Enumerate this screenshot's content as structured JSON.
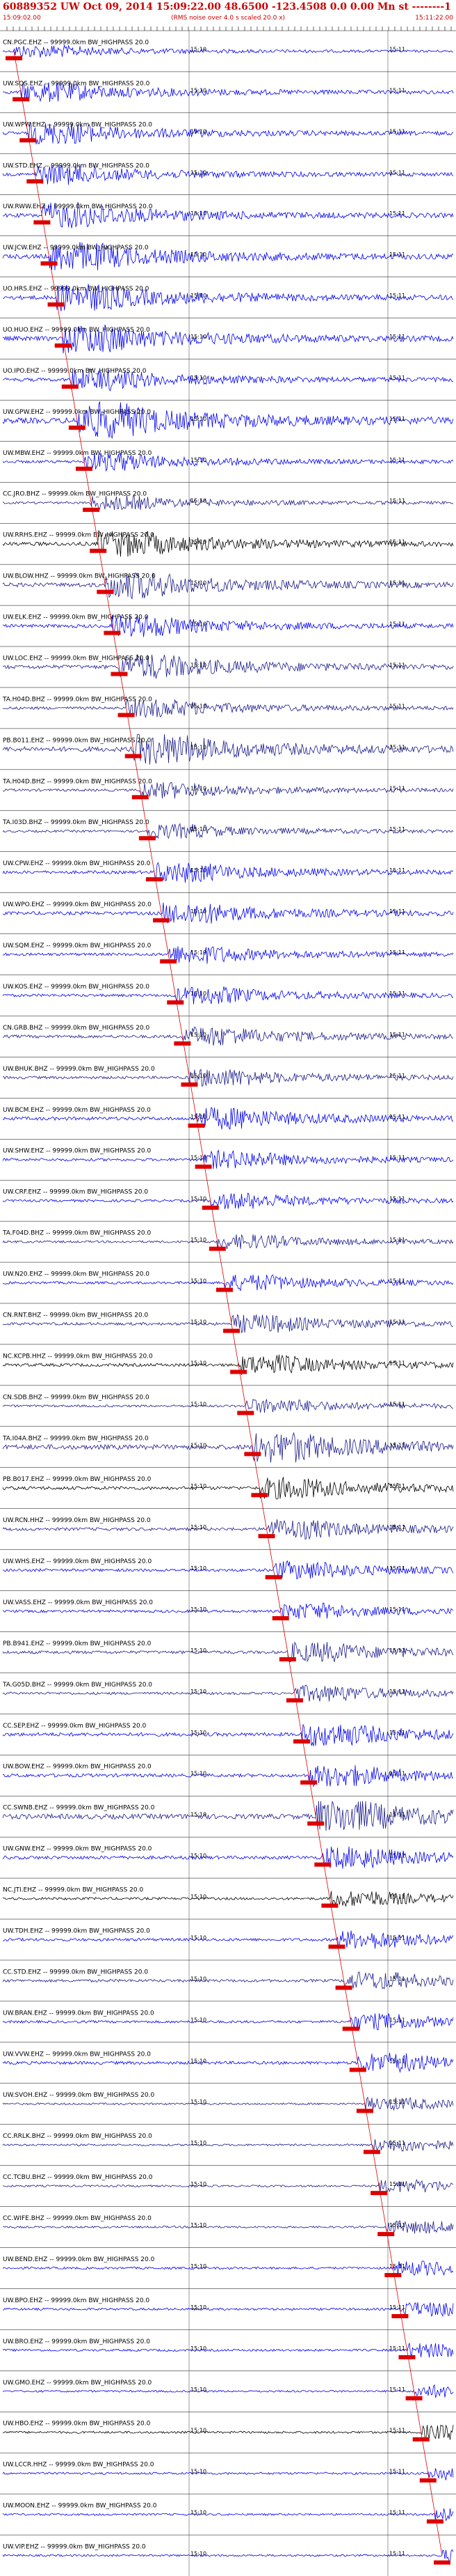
{
  "header": {
    "title": "60889352 UW Oct 09, 2014 15:09:22.00   48.6500 -123.4508  0.0 0.00 Mn st --------1",
    "start_time": "15:09:02.00",
    "scale_note": "(RMS noise over 4.0 s scaled 20.0 x)",
    "end_time": "15:11:22.00"
  },
  "chart_data": {
    "type": "line",
    "title": "60889352 UW Oct 09, 2014 15:09:22.00   48.6500 -123.4508  0.0 0.00 Mn st --------1",
    "x_time_labels": [
      "15:10",
      "15:11"
    ],
    "filter_suffix": "-- 99999.0km BW_HIGHPASS",
    "series_colors": [
      "#0000ee",
      "#1a1a8c",
      "#000000"
    ],
    "traces": [
      {
        "label": "CN.PGC.EHZ -- 99999.0km BW_HIGHPASS 20.0",
        "color": "#0000ee",
        "amp": 0.35
      },
      {
        "label": "UW.SQS.EHZ -- 99999.0km BW_HIGHPASS 20.0",
        "color": "#0000ee",
        "amp": 0.55
      },
      {
        "label": "UW.WPW.EHZ -- 99999.0km BW_HIGHPASS 20.0",
        "color": "#0000ee",
        "amp": 0.6
      },
      {
        "label": "UW.STD.EHZ -- 99999.0km BW_HIGHPASS 20.0",
        "color": "#0000ee",
        "amp": 0.55
      },
      {
        "label": "UW.RWW.EHZ -- 99999.0km BW_HIGHPASS 20.0",
        "color": "#0000ee",
        "amp": 0.7
      },
      {
        "label": "UW.JCW.EHZ -- 99999.0km BW_HIGHPASS 20.0",
        "color": "#0000ee",
        "amp": 0.8
      },
      {
        "label": "UO.HRS.EHZ -- 99999.0km BW_HIGHPASS 20.0",
        "color": "#0000ee",
        "amp": 0.75
      },
      {
        "label": "UO.HUO.EHZ -- 99999.0km BW_HIGHPASS 20.0",
        "color": "#0000ee",
        "amp": 0.8
      },
      {
        "label": "UO.IPO.EHZ -- 99999.0km BW_HIGHPASS 20.0",
        "color": "#0000ee",
        "amp": 0.6
      },
      {
        "label": "UW.GPW.EHZ -- 99999.0km BW_HIGHPASS 20.0",
        "color": "#0000ee",
        "amp": 1.0
      },
      {
        "label": "UW.MBW.EHZ -- 99999.0km BW_HIGHPASS 20.0",
        "color": "#0000ee",
        "amp": 0.5
      },
      {
        "label": "CC.JRO.BHZ -- 99999.0km BW_HIGHPASS 20.0",
        "color": "#1a1a8c",
        "amp": 0.4
      },
      {
        "label": "UW.RRHS.EHZ -- 99999.0km BW_HIGHPASS 20.0",
        "color": "#000000",
        "amp": 0.7
      },
      {
        "label": "UW.BLOW.HHZ -- 99999.0km BW_HIGHPASS 20.0",
        "color": "#1a1a8c",
        "amp": 0.75
      },
      {
        "label": "UW.ELK.EHZ -- 99999.0km BW_HIGHPASS 20.0",
        "color": "#0000ee",
        "amp": 0.6
      },
      {
        "label": "UW.LOC.EHZ -- 99999.0km BW_HIGHPASS 20.0",
        "color": "#1a1a8c",
        "amp": 0.7
      },
      {
        "label": "TA.H04D.BHZ -- 99999.0km BW_HIGHPASS 20.0",
        "color": "#1a1a8c",
        "amp": 0.5
      },
      {
        "label": "PB.B011.EHZ -- 99999.0km BW_HIGHPASS 20.0",
        "color": "#1a1a8c",
        "amp": 0.85
      },
      {
        "label": "TA.H04D.BHZ -- 99999.0km BW_HIGHPASS 20.0",
        "color": "#1a1a8c",
        "amp": 0.45
      },
      {
        "label": "TA.I03D.BHZ -- 99999.0km BW_HIGHPASS 20.0",
        "color": "#1a1a8c",
        "amp": 0.4
      },
      {
        "label": "UW.CPW.EHZ -- 99999.0km BW_HIGHPASS 20.0",
        "color": "#0000ee",
        "amp": 0.55
      },
      {
        "label": "UW.WPO.EHZ -- 99999.0km BW_HIGHPASS 20.0",
        "color": "#0000ee",
        "amp": 0.6
      },
      {
        "label": "UW.SQM.EHZ -- 99999.0km BW_HIGHPASS 20.0",
        "color": "#0000ee",
        "amp": 0.5
      },
      {
        "label": "UW.KOS.EHZ -- 99999.0km BW_HIGHPASS 20.0",
        "color": "#0000ee",
        "amp": 0.5
      },
      {
        "label": "CN.GRB.BHZ -- 99999.0km BW_HIGHPASS 20.0",
        "color": "#1a1a8c",
        "amp": 0.55
      },
      {
        "label": "UW.BHUK.BHZ -- 99999.0km BW_HIGHPASS 20.0",
        "color": "#1a1a8c",
        "amp": 0.5
      },
      {
        "label": "UW.BCM.EHZ -- 99999.0km BW_HIGHPASS 20.0",
        "color": "#0000ee",
        "amp": 0.6
      },
      {
        "label": "UW.SHW.EHZ -- 99999.0km BW_HIGHPASS 20.0",
        "color": "#0000ee",
        "amp": 0.5
      },
      {
        "label": "UW.CRF.EHZ -- 99999.0km BW_HIGHPASS 20.0",
        "color": "#0000ee",
        "amp": 0.45
      },
      {
        "label": "TA.F04D.BHZ -- 99999.0km BW_HIGHPASS 20.0",
        "color": "#1a1a8c",
        "amp": 0.4
      },
      {
        "label": "UW.N20.EHZ -- 99999.0km BW_HIGHPASS 20.0",
        "color": "#0000ee",
        "amp": 0.45
      },
      {
        "label": "CN.RNT.BHZ -- 99999.0km BW_HIGHPASS 20.0",
        "color": "#1a1a8c",
        "amp": 0.5
      },
      {
        "label": "NC.KCPB.HHZ -- 99999.0km BW_HIGHPASS 20.0",
        "color": "#000000",
        "amp": 0.55
      },
      {
        "label": "CN.SDB.BHZ -- 99999.0km BW_HIGHPASS 20.0",
        "color": "#1a1a8c",
        "amp": 0.4
      },
      {
        "label": "TA.I04A.BHZ -- 99999.0km BW_HIGHPASS 20.0",
        "color": "#1a1a8c",
        "amp": 0.85
      },
      {
        "label": "PB.B017.EHZ -- 99999.0km BW_HIGHPASS 20.0",
        "color": "#000000",
        "amp": 0.6
      },
      {
        "label": "UW.RCN.HHZ -- 99999.0km BW_HIGHPASS 20.0",
        "color": "#1a1a8c",
        "amp": 0.55
      },
      {
        "label": "UW.WHS.EHZ -- 99999.0km BW_HIGHPASS 20.0",
        "color": "#0000ee",
        "amp": 0.5
      },
      {
        "label": "UW.VASS.EHZ -- 99999.0km BW_HIGHPASS 20.0",
        "color": "#0000ee",
        "amp": 0.45
      },
      {
        "label": "PB.B941.EHZ -- 99999.0km BW_HIGHPASS 20.0",
        "color": "#1a1a8c",
        "amp": 0.55
      },
      {
        "label": "TA.G05D.BHZ -- 99999.0km BW_HIGHPASS 20.0",
        "color": "#1a1a8c",
        "amp": 0.45
      },
      {
        "label": "CC.SEP.EHZ -- 99999.0km BW_HIGHPASS 20.0",
        "color": "#0000ee",
        "amp": 0.65
      },
      {
        "label": "UW.BOW.EHZ -- 99999.0km BW_HIGHPASS 20.0",
        "color": "#0000ee",
        "amp": 0.6
      },
      {
        "label": "CC.SWNB.EHZ -- 99999.0km BW_HIGHPASS 20.0",
        "color": "#1a1a8c",
        "amp": 0.9
      },
      {
        "label": "UW.GNW.EHZ -- 99999.0km BW_HIGHPASS 20.0",
        "color": "#0000ee",
        "amp": 0.6
      },
      {
        "label": "NC.JTI.EHZ -- 99999.0km BW_HIGHPASS 20.0",
        "color": "#000000",
        "amp": 0.45
      },
      {
        "label": "UW.TDH.EHZ -- 99999.0km BW_HIGHPASS 20.0",
        "color": "#0000ee",
        "amp": 0.5
      },
      {
        "label": "CC.STD.EHZ -- 99999.0km BW_HIGHPASS 20.0",
        "color": "#1a1a8c",
        "amp": 0.5
      },
      {
        "label": "UW.BRAN.EHZ -- 99999.0km BW_HIGHPASS 20.0",
        "color": "#0000ee",
        "amp": 0.45
      },
      {
        "label": "UW.VVW.EHZ -- 99999.0km BW_HIGHPASS 20.0",
        "color": "#0000ee",
        "amp": 0.55
      },
      {
        "label": "UW.SVOH.EHZ -- 99999.0km BW_HIGHPASS 20.0",
        "color": "#1a1a8c",
        "amp": 0.35
      },
      {
        "label": "CC.RRLK.BHZ -- 99999.0km BW_HIGHPASS 20.0",
        "color": "#1a1a8c",
        "amp": 0.35
      },
      {
        "label": "CC.TCBU.BHZ -- 99999.0km BW_HIGHPASS 20.0",
        "color": "#1a1a8c",
        "amp": 0.35
      },
      {
        "label": "CC.WIFE.BHZ -- 99999.0km BW_HIGHPASS 20.0",
        "color": "#1a1a8c",
        "amp": 0.35
      },
      {
        "label": "UW.BEND.EHZ -- 99999.0km BW_HIGHPASS 20.0",
        "color": "#0000ee",
        "amp": 0.4
      },
      {
        "label": "UW.BPO.EHZ -- 99999.0km BW_HIGHPASS 20.0",
        "color": "#0000ee",
        "amp": 0.4
      },
      {
        "label": "UW.BRO.EHZ -- 99999.0km BW_HIGHPASS 20.0",
        "color": "#0000ee",
        "amp": 0.4
      },
      {
        "label": "UW.GMO.EHZ -- 99999.0km BW_HIGHPASS 20.0",
        "color": "#0000ee",
        "amp": 0.35
      },
      {
        "label": "UW.HBO.EHZ -- 99999.0km BW_HIGHPASS 20.0",
        "color": "#000000",
        "amp": 0.4
      },
      {
        "label": "UW.LCCR.HHZ -- 99999.0km BW_HIGHPASS 20.0",
        "color": "#0000ee",
        "amp": 0.4
      },
      {
        "label": "UW.MOON.EHZ -- 99999.0km BW_HIGHPASS 20.0",
        "color": "#0000ee",
        "amp": 0.35
      },
      {
        "label": "UW.VIP.EHZ -- 99999.0km BW_HIGHPASS 20.0",
        "color": "#0000ee",
        "amp": 0.35
      }
    ]
  }
}
